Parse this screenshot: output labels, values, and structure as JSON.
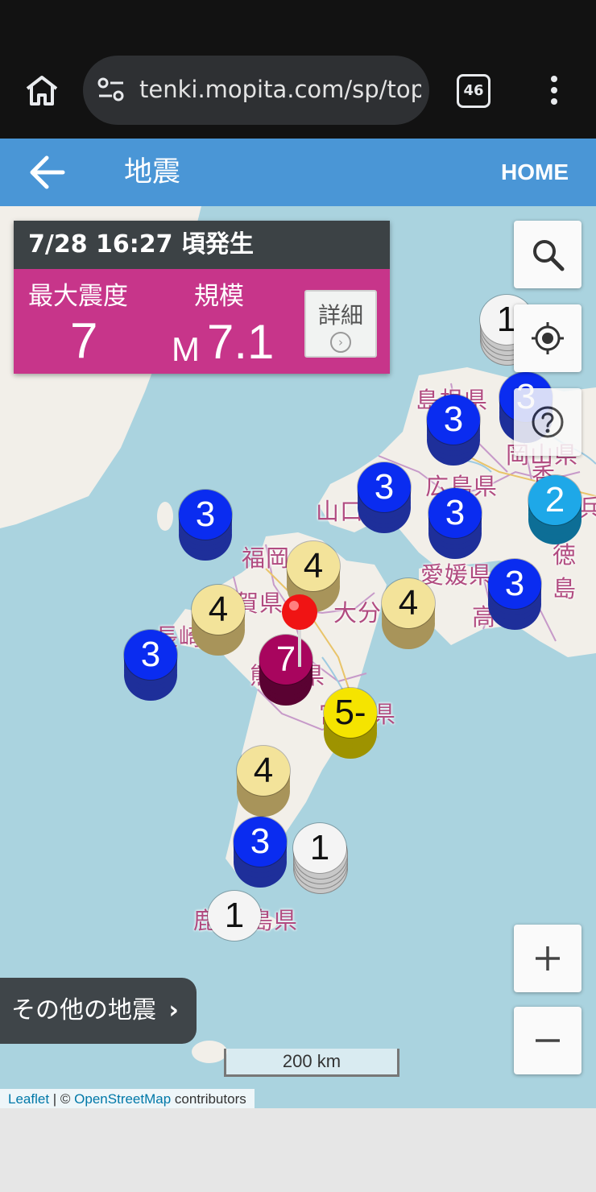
{
  "browser": {
    "url": "tenki.mopita.com/sp/top/#",
    "tab_count": "46"
  },
  "header": {
    "title": "地震",
    "home_label": "HOME"
  },
  "quake_info": {
    "time": "7/28 16:27 頃発生",
    "max_intensity_label": "最大震度",
    "max_intensity": "7",
    "scale_label": "規模",
    "magnitude_prefix": "M",
    "magnitude": "7.1",
    "detail_label": "詳細"
  },
  "prefecture_labels": [
    "島根県",
    "山口",
    "広島県",
    "岡山県",
    "福岡",
    "賀県",
    "大分",
    "愛媛県",
    "高",
    "長崎",
    "熊",
    "県",
    "宮",
    "県",
    "鹿",
    "島県",
    "徳島",
    "香",
    "兵"
  ],
  "intensity_markers": [
    "1",
    "3",
    "3",
    "3",
    "3",
    "2",
    "3",
    "4",
    "4",
    "4",
    "3",
    "7",
    "5-",
    "4",
    "3",
    "1",
    "1",
    "3"
  ],
  "other_quakes_label": "その他の地震",
  "scale_bar": "200 km",
  "attribution": {
    "leaflet": "Leaflet",
    "sep": " | © ",
    "osm": "OpenStreetMap",
    "contributors": " contributors"
  },
  "colors": {
    "header_blue": "#4a96d6",
    "panel_magenta": "#c7358a",
    "intensity_1": "#f4f4f4",
    "intensity_2": "#1ea8e8",
    "intensity_3": "#0a2cf0",
    "intensity_4": "#f3e39a",
    "intensity_5minus": "#f5e400",
    "intensity_7": "#a8055e"
  }
}
